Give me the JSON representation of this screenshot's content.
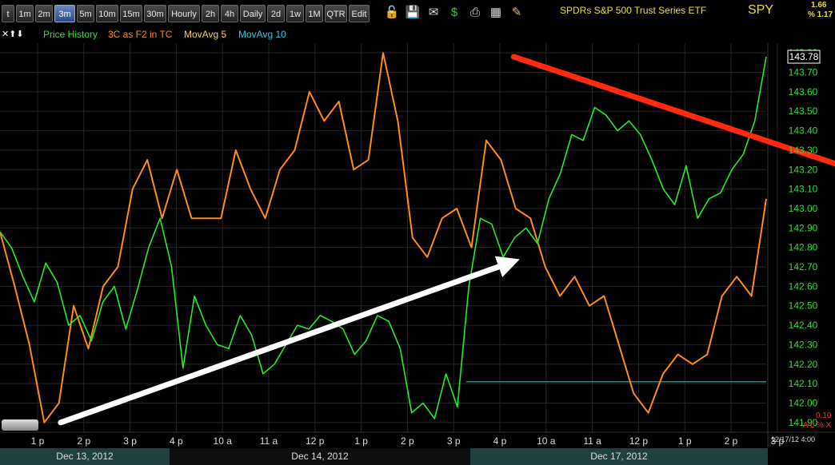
{
  "toolbar": {
    "buttons": [
      "t",
      "1m",
      "2m",
      "3m",
      "5m",
      "10m",
      "15m",
      "30m",
      "Hourly",
      "2h",
      "4h",
      "Daily",
      "2d",
      "1w",
      "1M",
      "QTR",
      "Edit"
    ],
    "active": "3m",
    "icons": [
      "lock-icon",
      "save-icon",
      "mail-icon",
      "dollar-icon",
      "print-icon",
      "settings-icon",
      "pencil-icon"
    ]
  },
  "header": {
    "title": "SPDRs S&P 500 Trust Series ETF",
    "symbol": "SPY",
    "change": "1.66",
    "pct_change": "% 1.17"
  },
  "legend": {
    "arrows": "✕⬆⬇",
    "items": [
      {
        "label": "Price History",
        "color": "#33dd33"
      },
      {
        "label": "3C as F2 in TC",
        "color": "#ff8c1a"
      },
      {
        "label": "MovAvg 5",
        "color": "#ffd24d"
      },
      {
        "label": "MovAvg 10",
        "color": "#33c8e8"
      }
    ]
  },
  "colors": {
    "price": "#22ee22",
    "indicator": "#ff8c1a",
    "hline": "#1f8f8f",
    "red_arrow": "#ff2a10",
    "white_arrow": "#ffffff",
    "grid": "#262626",
    "axis_text": "#33dd33"
  },
  "axis_footer": {
    "a": "0.10",
    "b": "A L % X",
    "c": "12/17/12 4:00"
  },
  "chart_data": {
    "type": "line",
    "x_ticks": [
      "1 p",
      "2 p",
      "3 p",
      "4 p",
      "10 a",
      "11 a",
      "12 p",
      "1 p",
      "2 p",
      "3 p",
      "4 p",
      "10 a",
      "11 a",
      "12 p",
      "1 p",
      "2 p",
      "3 p"
    ],
    "dates": [
      "Dec 13, 2012",
      "Dec 14, 2012",
      "Dec 17, 2012"
    ],
    "y_ticks": [
      143.8,
      143.7,
      143.6,
      143.5,
      143.4,
      143.3,
      143.2,
      143.1,
      143.0,
      142.9,
      142.8,
      142.7,
      142.6,
      142.5,
      142.4,
      142.3,
      142.2,
      142.1,
      142.0,
      141.9
    ],
    "ylim": [
      141.85,
      143.85
    ],
    "last_price": "143.78",
    "horizontal_line": 142.11,
    "series": [
      {
        "name": "Price History",
        "values": [
          142.88,
          142.8,
          142.65,
          142.52,
          142.72,
          142.62,
          142.4,
          142.45,
          142.32,
          142.52,
          142.6,
          142.38,
          142.58,
          142.8,
          142.95,
          142.7,
          142.18,
          142.55,
          142.4,
          142.3,
          142.28,
          142.45,
          142.35,
          142.15,
          142.2,
          142.3,
          142.4,
          142.38,
          142.45,
          142.42,
          142.38,
          142.25,
          142.32,
          142.45,
          142.42,
          142.28,
          141.95,
          142.0,
          141.92,
          142.15,
          141.98,
          142.6,
          142.95,
          142.92,
          142.75,
          142.85,
          142.9,
          142.82,
          143.05,
          143.18,
          143.38,
          143.35,
          143.52,
          143.48,
          143.4,
          143.45,
          143.38,
          143.25,
          143.1,
          143.02,
          143.22,
          142.95,
          143.05,
          143.08,
          143.2,
          143.28,
          143.45,
          143.78
        ]
      },
      {
        "name": "3C as F2 in TC",
        "values": [
          142.88,
          142.6,
          142.3,
          141.9,
          142.0,
          142.5,
          142.28,
          142.6,
          142.7,
          143.1,
          143.25,
          142.95,
          143.2,
          142.95,
          142.95,
          142.95,
          143.3,
          143.1,
          142.95,
          143.2,
          143.3,
          143.6,
          143.45,
          143.55,
          143.2,
          143.25,
          143.8,
          143.45,
          142.85,
          142.75,
          142.95,
          143.0,
          142.8,
          143.35,
          143.25,
          143.0,
          142.95,
          142.7,
          142.55,
          142.65,
          142.5,
          142.55,
          142.3,
          142.05,
          141.95,
          142.15,
          142.25,
          142.2,
          142.25,
          142.55,
          142.65,
          142.55,
          143.05
        ]
      }
    ],
    "annotations": [
      {
        "type": "arrow",
        "color": "white",
        "from": [
          0.5,
          141.9
        ],
        "to": [
          10.2,
          142.72
        ]
      },
      {
        "type": "arrow",
        "color": "red",
        "from": [
          10.3,
          143.78
        ],
        "to": [
          18.4,
          143.14
        ]
      }
    ]
  }
}
